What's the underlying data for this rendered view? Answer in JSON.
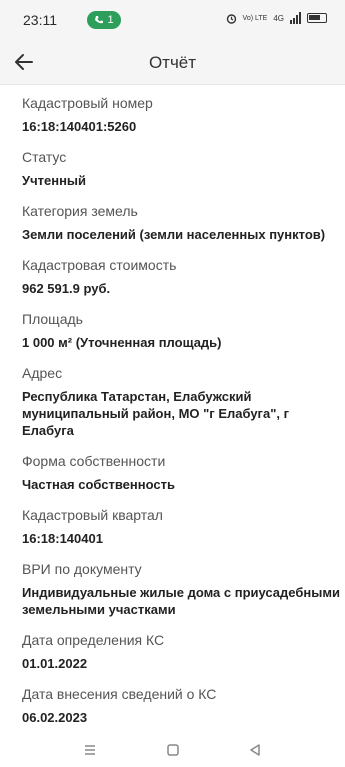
{
  "status_bar": {
    "time": "23:11",
    "chip_count": "1",
    "icons": [
      "alarm-icon",
      "volte-icon",
      "4g-icon",
      "signal-icon",
      "battery-icon"
    ],
    "volte_text": "Vo) LTE",
    "net_text": "4G"
  },
  "header": {
    "title": "Отчёт",
    "back_icon": "arrow-left-icon"
  },
  "fields": [
    {
      "label": "Кадастровый номер",
      "value": "16:18:140401:5260"
    },
    {
      "label": "Статус",
      "value": "Учтенный"
    },
    {
      "label": "Категория земель",
      "value": "Земли поселений (земли населенных пунктов)"
    },
    {
      "label": "Кадастровая стоимость",
      "value": "962 591.9 руб."
    },
    {
      "label": "Площадь",
      "value": "1 000 м² (Уточненная площадь)"
    },
    {
      "label": "Адрес",
      "value": "Республика Татарстан, Елабужский муниципальный район, МО \"г Елабуга\", г Елабуга"
    },
    {
      "label": "Форма собственности",
      "value": "Частная собственность"
    },
    {
      "label": "Кадастровый квартал",
      "value": "16:18:140401"
    },
    {
      "label": "ВРИ по документу",
      "value": "Индивидуальные жилые дома с приусадебными земельными участками"
    },
    {
      "label": "Дата определения КС",
      "value": "01.01.2022"
    },
    {
      "label": "Дата внесения сведений о КС",
      "value": "06.02.2023"
    }
  ],
  "nav": [
    "menu-icon",
    "home-icon",
    "back-icon"
  ],
  "colors": {
    "chip": "#2e9e5b",
    "background": "#ffffff",
    "header": "#f5f5f5"
  }
}
